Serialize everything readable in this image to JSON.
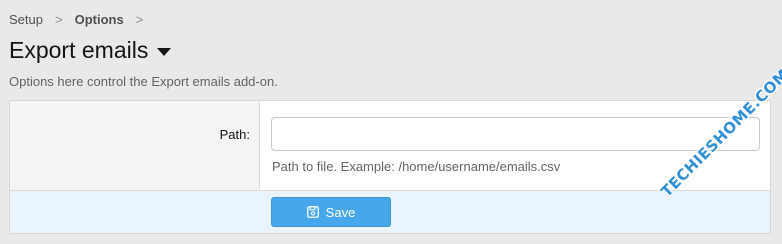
{
  "breadcrumb": {
    "items": [
      "Setup",
      "Options"
    ],
    "separator": ">"
  },
  "page": {
    "title": "Export emails",
    "description": "Options here control the Export emails add-on."
  },
  "form": {
    "path_label": "Path:",
    "path_value": "",
    "path_hint": "Path to file. Example: /home/username/emails.csv",
    "save_label": "Save",
    "save_icon": "floppy-disk-icon"
  },
  "watermark": {
    "text": "TECHIESHOME.COM"
  },
  "colors": {
    "accent": "#47a7eb",
    "footer_bg": "#eaf4fc",
    "page_bg": "#e9e9e9"
  }
}
